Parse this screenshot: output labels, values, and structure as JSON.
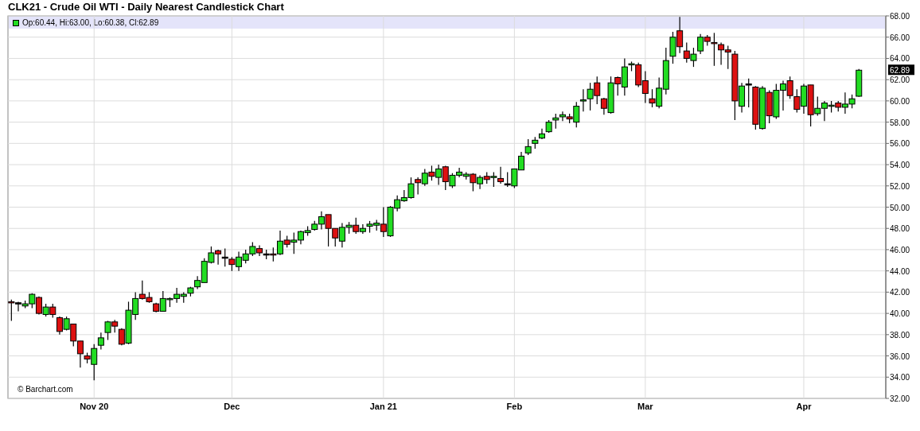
{
  "title": "CLK21 - Crude Oil WTI - Daily Nearest Candlestick Chart",
  "legend": "Op:60.44, Hi:63.00, Lo:60.38, Cl:62.89",
  "last_price_tag": "62.89",
  "credit": "© Barchart.com",
  "chart_data": {
    "type": "candlestick",
    "grid": true,
    "ylim": [
      32,
      68
    ],
    "yticks": [
      {
        "value": 32,
        "label": "32.00"
      },
      {
        "value": 34,
        "label": "34.00"
      },
      {
        "value": 36,
        "label": "36.00"
      },
      {
        "value": 38,
        "label": "38.00"
      },
      {
        "value": 40,
        "label": "40.00"
      },
      {
        "value": 42,
        "label": "42.00"
      },
      {
        "value": 44,
        "label": "44.00"
      },
      {
        "value": 46,
        "label": "46.00"
      },
      {
        "value": 48,
        "label": "48.00"
      },
      {
        "value": 50,
        "label": "50.00"
      },
      {
        "value": 52,
        "label": "52.00"
      },
      {
        "value": 54,
        "label": "54.00"
      },
      {
        "value": 56,
        "label": "56.00"
      },
      {
        "value": 58,
        "label": "58.00"
      },
      {
        "value": 60,
        "label": "60.00"
      },
      {
        "value": 62,
        "label": "62.00"
      },
      {
        "value": 64,
        "label": "64.00"
      },
      {
        "value": 66,
        "label": "66.00"
      },
      {
        "value": 68,
        "label": "68.00"
      }
    ],
    "categories": [
      null,
      null,
      null,
      null,
      null,
      null,
      null,
      null,
      null,
      null,
      null,
      null,
      "Nov 20",
      null,
      null,
      null,
      null,
      null,
      null,
      null,
      null,
      null,
      null,
      null,
      null,
      null,
      null,
      null,
      null,
      null,
      null,
      null,
      "Dec",
      null,
      null,
      null,
      null,
      null,
      null,
      null,
      null,
      null,
      null,
      null,
      null,
      null,
      null,
      null,
      null,
      null,
      null,
      null,
      null,
      null,
      "Jan 21",
      null,
      null,
      null,
      null,
      null,
      null,
      null,
      null,
      null,
      null,
      null,
      null,
      null,
      null,
      null,
      null,
      null,
      null,
      "Feb",
      null,
      null,
      null,
      null,
      null,
      null,
      null,
      null,
      null,
      null,
      null,
      null,
      null,
      null,
      null,
      null,
      null,
      null,
      "Mar",
      null,
      null,
      null,
      null,
      null,
      null,
      null,
      null,
      null,
      null,
      null,
      null,
      null,
      null,
      null,
      null,
      null,
      null,
      null,
      null,
      null,
      null,
      "Apr",
      null,
      null,
      null,
      null,
      null,
      null,
      null,
      null
    ],
    "ohlc": [
      [
        41.1,
        41.3,
        39.3,
        41.0
      ],
      [
        41.0,
        41.1,
        40.2,
        41.0
      ],
      [
        40.7,
        41.2,
        40.5,
        40.9
      ],
      [
        40.9,
        41.9,
        40.5,
        41.8
      ],
      [
        41.5,
        41.6,
        39.9,
        40.0
      ],
      [
        39.9,
        40.9,
        39.7,
        40.6
      ],
      [
        40.6,
        40.9,
        39.6,
        39.9
      ],
      [
        39.6,
        39.7,
        38.0,
        38.3
      ],
      [
        38.5,
        39.7,
        38.4,
        39.5
      ],
      [
        39.0,
        39.0,
        36.9,
        37.4
      ],
      [
        37.4,
        37.4,
        34.9,
        36.2
      ],
      [
        36.0,
        36.3,
        35.3,
        35.7
      ],
      [
        35.2,
        37.1,
        33.7,
        36.7
      ],
      [
        37.0,
        38.2,
        36.6,
        37.7
      ],
      [
        38.2,
        39.3,
        37.5,
        39.2
      ],
      [
        39.2,
        39.4,
        38.2,
        38.8
      ],
      [
        38.5,
        38.6,
        37.0,
        37.1
      ],
      [
        37.2,
        41.1,
        37.1,
        40.3
      ],
      [
        39.9,
        42.0,
        39.4,
        41.4
      ],
      [
        41.8,
        43.1,
        41.3,
        41.4
      ],
      [
        41.5,
        42.0,
        41.0,
        41.1
      ],
      [
        40.9,
        41.0,
        40.1,
        40.2
      ],
      [
        40.2,
        42.1,
        40.2,
        41.4
      ],
      [
        41.3,
        41.5,
        40.6,
        41.4
      ],
      [
        41.4,
        42.4,
        41.0,
        41.8
      ],
      [
        41.6,
        42.0,
        41.0,
        41.8
      ],
      [
        41.9,
        42.5,
        41.6,
        42.4
      ],
      [
        42.5,
        43.5,
        42.3,
        43.1
      ],
      [
        42.9,
        45.2,
        42.9,
        44.9
      ],
      [
        44.8,
        46.3,
        44.7,
        45.7
      ],
      [
        45.9,
        46.0,
        44.6,
        45.6
      ],
      [
        45.3,
        46.1,
        44.4,
        45.3
      ],
      [
        45.1,
        45.3,
        44.0,
        44.6
      ],
      [
        44.4,
        45.8,
        44.0,
        45.3
      ],
      [
        45.0,
        46.0,
        44.7,
        45.6
      ],
      [
        45.6,
        46.7,
        45.4,
        46.3
      ],
      [
        46.1,
        46.4,
        45.4,
        45.7
      ],
      [
        45.6,
        46.0,
        45.1,
        45.6
      ],
      [
        45.6,
        46.2,
        44.9,
        45.5
      ],
      [
        45.6,
        47.8,
        45.5,
        46.8
      ],
      [
        46.9,
        47.3,
        46.2,
        46.5
      ],
      [
        46.7,
        47.6,
        45.6,
        46.9
      ],
      [
        46.9,
        47.8,
        46.5,
        47.7
      ],
      [
        47.6,
        48.2,
        47.3,
        47.8
      ],
      [
        47.9,
        48.7,
        47.8,
        48.4
      ],
      [
        48.4,
        49.6,
        47.9,
        49.1
      ],
      [
        49.3,
        49.3,
        46.3,
        48.0
      ],
      [
        48.0,
        48.0,
        46.3,
        47.1
      ],
      [
        46.8,
        48.5,
        46.2,
        48.1
      ],
      [
        48.1,
        48.6,
        47.5,
        48.3
      ],
      [
        48.3,
        49.0,
        47.5,
        47.7
      ],
      [
        47.7,
        48.4,
        47.5,
        48.0
      ],
      [
        48.2,
        48.7,
        47.6,
        48.4
      ],
      [
        48.3,
        48.8,
        47.8,
        48.5
      ],
      [
        48.4,
        50.0,
        47.2,
        47.7
      ],
      [
        47.3,
        50.1,
        47.2,
        50.0
      ],
      [
        49.9,
        51.1,
        49.6,
        50.7
      ],
      [
        50.6,
        51.6,
        50.5,
        50.9
      ],
      [
        50.9,
        52.8,
        50.8,
        52.2
      ],
      [
        52.6,
        52.8,
        51.2,
        52.3
      ],
      [
        52.2,
        53.6,
        52.0,
        53.2
      ],
      [
        53.3,
        53.9,
        52.5,
        52.9
      ],
      [
        52.8,
        54.0,
        52.1,
        53.6
      ],
      [
        53.8,
        53.9,
        51.6,
        52.4
      ],
      [
        52.0,
        53.2,
        51.8,
        53.0
      ],
      [
        53.0,
        53.7,
        52.8,
        53.3
      ],
      [
        52.9,
        53.3,
        52.6,
        53.1
      ],
      [
        53.1,
        53.2,
        51.5,
        52.3
      ],
      [
        52.2,
        53.0,
        51.7,
        52.8
      ],
      [
        52.9,
        53.3,
        52.2,
        52.6
      ],
      [
        52.8,
        53.3,
        51.9,
        52.9
      ],
      [
        52.7,
        53.8,
        52.2,
        52.4
      ],
      [
        52.2,
        53.3,
        51.9,
        52.2
      ],
      [
        52.0,
        53.6,
        51.8,
        53.6
      ],
      [
        53.5,
        55.2,
        53.5,
        54.8
      ],
      [
        55.1,
        56.4,
        54.9,
        55.7
      ],
      [
        56.0,
        56.6,
        55.5,
        56.3
      ],
      [
        56.5,
        57.4,
        56.4,
        56.9
      ],
      [
        57.1,
        58.2,
        57.0,
        58.0
      ],
      [
        58.2,
        58.8,
        57.4,
        58.4
      ],
      [
        58.5,
        59.0,
        58.1,
        58.7
      ],
      [
        58.5,
        58.8,
        57.9,
        58.3
      ],
      [
        58.0,
        59.9,
        57.5,
        59.5
      ],
      [
        60.0,
        61.1,
        59.0,
        60.1
      ],
      [
        60.2,
        61.7,
        59.1,
        61.1
      ],
      [
        61.7,
        62.3,
        59.7,
        60.5
      ],
      [
        60.2,
        60.3,
        58.7,
        59.3
      ],
      [
        58.9,
        62.3,
        58.8,
        61.7
      ],
      [
        62.2,
        62.3,
        60.5,
        61.6
      ],
      [
        61.3,
        64.0,
        60.5,
        63.2
      ],
      [
        63.4,
        63.7,
        62.8,
        63.5
      ],
      [
        63.4,
        63.6,
        61.3,
        61.5
      ],
      [
        61.9,
        62.8,
        59.8,
        60.7
      ],
      [
        60.2,
        61.1,
        59.4,
        59.8
      ],
      [
        59.5,
        62.2,
        59.3,
        61.2
      ],
      [
        61.1,
        65.0,
        60.6,
        63.8
      ],
      [
        64.2,
        66.5,
        63.5,
        66.0
      ],
      [
        66.6,
        67.9,
        64.5,
        65.1
      ],
      [
        64.7,
        65.5,
        63.6,
        64.0
      ],
      [
        63.8,
        65.0,
        63.2,
        64.4
      ],
      [
        64.7,
        66.3,
        64.4,
        66.0
      ],
      [
        66.0,
        66.2,
        65.2,
        65.6
      ],
      [
        65.5,
        66.4,
        63.3,
        65.4
      ],
      [
        65.3,
        65.5,
        63.4,
        64.8
      ],
      [
        64.8,
        65.2,
        63.0,
        64.6
      ],
      [
        64.4,
        64.7,
        58.2,
        60.0
      ],
      [
        59.5,
        61.7,
        58.9,
        61.4
      ],
      [
        61.6,
        62.1,
        59.4,
        61.6
      ],
      [
        61.3,
        61.4,
        57.3,
        57.8
      ],
      [
        57.4,
        61.4,
        57.3,
        61.2
      ],
      [
        60.8,
        61.0,
        57.9,
        58.6
      ],
      [
        58.5,
        61.6,
        58.3,
        61.0
      ],
      [
        61.0,
        61.9,
        59.1,
        61.6
      ],
      [
        61.9,
        62.3,
        60.2,
        60.5
      ],
      [
        60.4,
        61.1,
        58.9,
        59.2
      ],
      [
        59.5,
        61.6,
        58.8,
        61.4
      ],
      [
        61.5,
        61.5,
        57.6,
        58.7
      ],
      [
        58.8,
        60.4,
        58.6,
        59.3
      ],
      [
        59.3,
        60.0,
        58.1,
        59.8
      ],
      [
        59.5,
        60.0,
        58.9,
        59.6
      ],
      [
        59.8,
        60.0,
        59.0,
        59.4
      ],
      [
        59.4,
        60.8,
        58.8,
        59.7
      ],
      [
        59.7,
        60.6,
        59.3,
        60.2
      ],
      [
        60.44,
        63.0,
        60.38,
        62.89
      ]
    ]
  }
}
